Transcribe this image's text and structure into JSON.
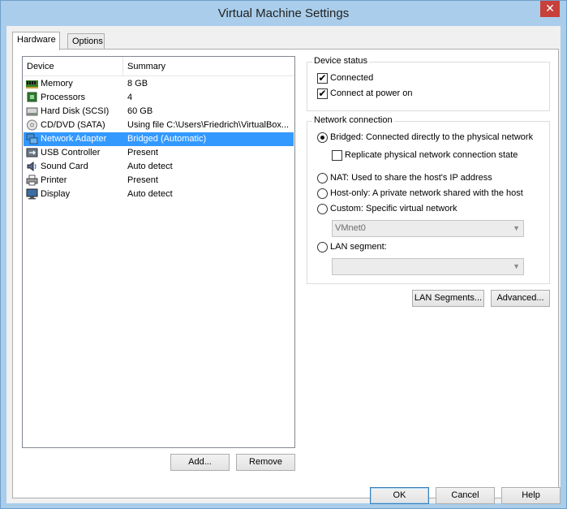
{
  "window": {
    "title": "Virtual Machine Settings",
    "close_glyph": "✕"
  },
  "tabs": [
    {
      "label": "Hardware",
      "active": true
    },
    {
      "label": "Options",
      "active": false
    }
  ],
  "device_list": {
    "headers": {
      "device": "Device",
      "summary": "Summary"
    },
    "rows": [
      {
        "icon": "memory-icon",
        "device": "Memory",
        "summary": "8 GB"
      },
      {
        "icon": "processor-icon",
        "device": "Processors",
        "summary": "4"
      },
      {
        "icon": "hard-disk-icon",
        "device": "Hard Disk (SCSI)",
        "summary": "60 GB"
      },
      {
        "icon": "cd-dvd-icon",
        "device": "CD/DVD (SATA)",
        "summary": "Using file C:\\Users\\Friedrich\\VirtualBox..."
      },
      {
        "icon": "network-adapter-icon",
        "device": "Network Adapter",
        "summary": "Bridged (Automatic)",
        "selected": true
      },
      {
        "icon": "usb-icon",
        "device": "USB Controller",
        "summary": "Present"
      },
      {
        "icon": "sound-card-icon",
        "device": "Sound Card",
        "summary": "Auto detect"
      },
      {
        "icon": "printer-icon",
        "device": "Printer",
        "summary": "Present"
      },
      {
        "icon": "display-icon",
        "device": "Display",
        "summary": "Auto detect"
      }
    ]
  },
  "list_buttons": {
    "add": "Add...",
    "remove": "Remove"
  },
  "device_status": {
    "label": "Device status",
    "connected": {
      "label": "Connected",
      "checked": true
    },
    "connect_at_power_on": {
      "label": "Connect at power on",
      "checked": true
    }
  },
  "network_connection": {
    "label": "Network connection",
    "bridged": {
      "label": "Bridged: Connected directly to the physical network",
      "selected": true
    },
    "replicate": {
      "label": "Replicate physical network connection state",
      "checked": false
    },
    "nat": {
      "label": "NAT: Used to share the host's IP address",
      "selected": false
    },
    "host_only": {
      "label": "Host-only: A private network shared with the host",
      "selected": false
    },
    "custom": {
      "label": "Custom: Specific virtual network",
      "selected": false
    },
    "vmnet_select": {
      "value": "VMnet0"
    },
    "lan_segment": {
      "label": "LAN segment:",
      "selected": false
    },
    "lan_select": {
      "value": ""
    }
  },
  "network_buttons": {
    "lan_segments": "LAN Segments...",
    "advanced": "Advanced..."
  },
  "footer": {
    "ok": "OK",
    "cancel": "Cancel",
    "help": "Help"
  },
  "colors": {
    "selection": "#3399ff",
    "titlebar": "#a9cdea",
    "close": "#c7403a"
  }
}
